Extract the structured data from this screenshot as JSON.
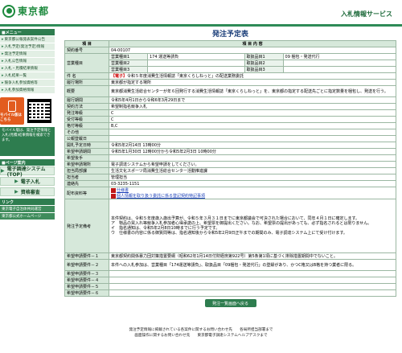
{
  "header": {
    "logo": "東京都",
    "service": "入札情報サービス"
  },
  "sidebar": {
    "menu_head": "■メニュー",
    "items": [
      {
        "label": "東京都公報発表案件公告"
      },
      {
        "label": "入札予定(発注予定)情報"
      },
      {
        "label": "発注予定情報"
      },
      {
        "label": "入札公告情報"
      },
      {
        "label": "入札・見積結果情報"
      },
      {
        "label": "入札結果一覧"
      },
      {
        "label": "競争入札参加資格等"
      },
      {
        "label": "入札参加資格情報"
      }
    ],
    "mobile_label": "モバイル版はこちら",
    "mobile_note": "モバイル版は、発注予定情報と入札(見積)結果情報を検索できます。",
    "side_head2": "■ページ案内",
    "buttons": [
      {
        "label": "電子調達システム(TOP)"
      },
      {
        "label": "電子入札"
      },
      {
        "label": "資格審査"
      }
    ],
    "link_head": "リンク",
    "links": [
      {
        "label": "東京電子自治体共同運営"
      },
      {
        "label": "東京都公式ホームページ"
      }
    ]
  },
  "main": {
    "title": "発注予定表",
    "col_item": "項 目",
    "col_content": "項 目 内 容",
    "rows": [
      {
        "label": "契約番号",
        "value": "04-00107"
      },
      {
        "label": "",
        "g1": "営業種目1",
        "g1v": "174 運送等請負",
        "g2": "取扱品目1",
        "g2v": "09 梱包・発送代行"
      },
      {
        "label": "営業種目",
        "g1": "営業種目2",
        "g1v": "",
        "g2": "取扱品目2",
        "g2v": ""
      },
      {
        "label": "",
        "g1": "営業種目3",
        "g1v": "",
        "g2": "取扱品目3",
        "g2v": ""
      },
      {
        "label": "件 名",
        "tag": "【電子】",
        "value": "令和５年度消費生活情報誌「東京くらしねっと」の配送業務委託"
      },
      {
        "label": "履行場所",
        "value": "東京都が指定する場所"
      },
      {
        "label": "概要",
        "value": "東京都消費生活総合センターが年６回発行する消費生活情報誌「東京くらしねっと」を、東京都の指定する配送先ごとに指定数量を梱包し、発送を行う。"
      },
      {
        "label": "履行期間",
        "value": "令和5年4月1日から令和6年3月29日まで"
      },
      {
        "label": "契約方法",
        "value": "希望制指名競争入札"
      },
      {
        "label": "発注等級",
        "value": "C"
      },
      {
        "label": "受付等級",
        "value": "C"
      },
      {
        "label": "格付等級",
        "value": "B,C"
      },
      {
        "label": "その他",
        "value": ""
      },
      {
        "label": "公報登載日",
        "value": ""
      },
      {
        "label": "開札予定日時",
        "value": "令和5年2月14日 13時00分"
      },
      {
        "label": "希望申請期間",
        "value": "令和5年1月30日 12時00分から令和5年2月3日 10時00分"
      },
      {
        "label": "希望後手",
        "value": ""
      },
      {
        "label": "希望申請場所",
        "value": "電子調達システムから希望申請をしてください。"
      },
      {
        "label": "担当局部課",
        "value": "生活文化スポーツ局消費生活総合センター活動推進課"
      },
      {
        "label": "担当者",
        "value": "管理担当"
      },
      {
        "label": "連絡先",
        "value": "03-3235-1151"
      },
      {
        "label": "配布資料等",
        "link1": "仕様書",
        "link2": "個人情報を取り扱う委託に係る登記契約特記事項"
      },
      {
        "label": "発注予定備考",
        "value": "本件契約は、令和５年度歳入歳出予算が、令和５年３月３１日までに東京都議会で可決された場合において、同年４月１日に確定します。\nア　物品の買入れ等競争入札参加者心得承諾の上、希望票を御提出ください。なお、希望票の提出があっても、必ず指名されるとは限りません。\nイ　指名通知は、令和5年2月8日10時までに行う予定です。\nウ　仕様書の内容に係る御質問等は、指名通知後から令和5年2月9日正午までの期間のみ、電子調達システム上にて受け付けます。"
      },
      {
        "label": "希望申請要件－１",
        "value": "東京都契約関係暴力団対策措置要綱（昭和62年1月14日付財経庶第922号）第5条第1項に基づく排除措置期間中でないこと。"
      },
      {
        "label": "希望申請要件－２",
        "value": "本件への入札参加は、営業種目「174運送等請負」、取扱品目「09梱包・発送代行」の登録があり、かつC格又はB格を持つ業者に限る。"
      },
      {
        "label": "希望申請要件－３",
        "value": ""
      },
      {
        "label": "希望申請要件－４",
        "value": ""
      },
      {
        "label": "希望申請要件－５",
        "value": ""
      },
      {
        "label": "希望申請要件－６",
        "value": ""
      }
    ],
    "back_button": "発注一覧画面へ戻る"
  },
  "footer": {
    "line1": "発注予定情報に掲載されている各案件に関するお問い合わせ先　　各局所担当部署まで",
    "line2": "画面操作に関するお問い合わせ先　　東京都電子調達システムヘルプデスクまで"
  },
  "colors": {
    "brand": "#1d8a3e",
    "sidebar": "#2e7d4f",
    "header_cell": "#d6e8da",
    "title": "#1c3f7a"
  }
}
